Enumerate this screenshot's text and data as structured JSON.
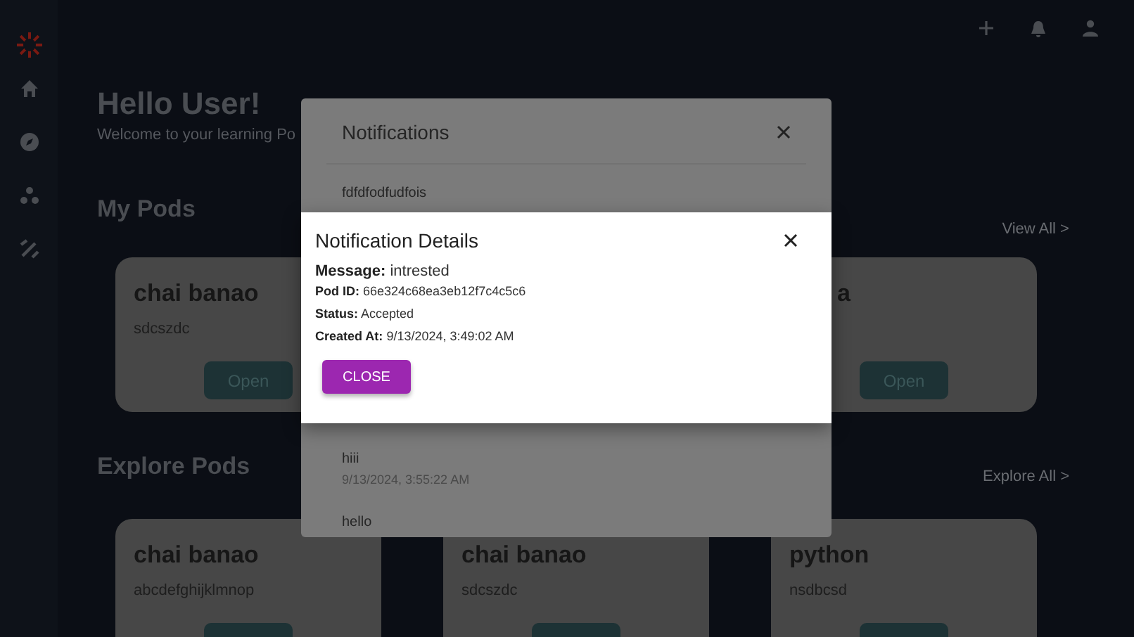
{
  "greeting": {
    "title": "Hello User!",
    "subtitle": "Welcome to your learning Po"
  },
  "my_pods": {
    "heading": "My Pods",
    "link": "View All >",
    "cards": [
      {
        "title": "chai banao",
        "description": "sdcszdc",
        "button": "Open"
      },
      {
        "title": "a",
        "button": "Open"
      }
    ]
  },
  "explore_pods": {
    "heading": "Explore Pods",
    "link": "Explore All >",
    "cards": [
      {
        "title": "chai banao",
        "description": "abcdefghijklmnop"
      },
      {
        "title": "chai banao",
        "description": "sdcszdc"
      },
      {
        "title": "python",
        "description": "nsdbcsd"
      }
    ]
  },
  "notifications": {
    "title": "Notifications",
    "items": [
      {
        "message": "fdfdfodfudfois"
      },
      {
        "message": "hiii",
        "time": "9/13/2024, 3:55:22 AM"
      },
      {
        "message": "hello"
      }
    ]
  },
  "details": {
    "title": "Notification Details",
    "fields": [
      {
        "label": "Message:",
        "value": "intrested",
        "kind": "large"
      },
      {
        "label": "Pod ID:",
        "value": "66e324c68ea3eb12f7c4c5c6",
        "kind": "small"
      },
      {
        "label": "Status:",
        "value": "Accepted",
        "kind": "small"
      },
      {
        "label": "Created At:",
        "value": "9/13/2024, 3:49:02 AM",
        "kind": "small"
      }
    ],
    "button": "CLOSE"
  }
}
